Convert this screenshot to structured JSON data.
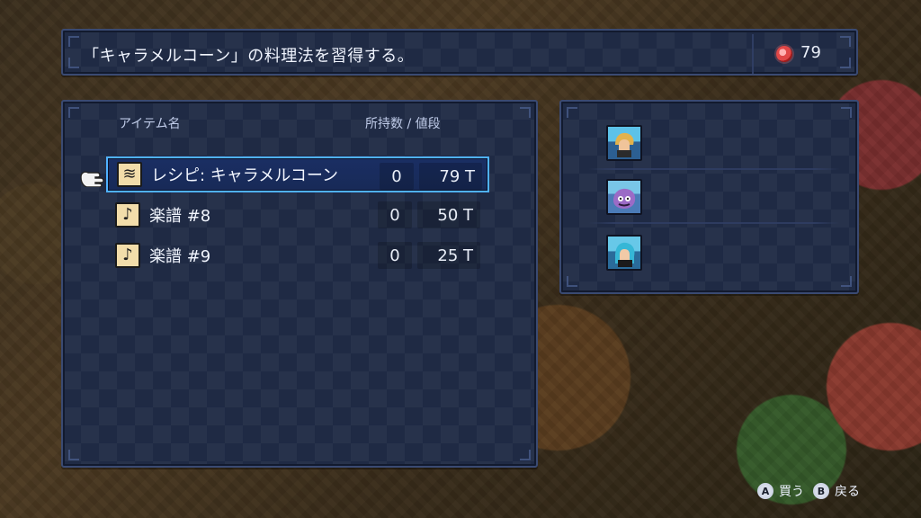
{
  "message": {
    "text": "「キャラメルコーン」の料理法を習得する。"
  },
  "currency": {
    "amount": "79",
    "icon": "coin-icon"
  },
  "shop": {
    "headers": {
      "item": "アイテム名",
      "owned_price": "所持数 / 値段"
    },
    "items": [
      {
        "name": "レシピ: キャラメルコーン",
        "qty": "0",
        "price": "79 T",
        "icon": "scroll-icon",
        "selected": true
      },
      {
        "name": "楽譜 #8",
        "qty": "0",
        "price": "50 T",
        "icon": "music-note-icon",
        "selected": false
      },
      {
        "name": "楽譜 #9",
        "qty": "0",
        "price": "25 T",
        "icon": "music-note-icon",
        "selected": false
      }
    ]
  },
  "party": {
    "members": [
      {
        "portrait": "blonde-hero-portrait"
      },
      {
        "portrait": "purple-creature-portrait"
      },
      {
        "portrait": "blue-hair-portrait"
      }
    ]
  },
  "help": {
    "a_label": "買う",
    "b_label": "戻る",
    "a_button": "A",
    "b_button": "B"
  },
  "colors": {
    "panel_bg": "#1f2a44",
    "panel_border": "#3a4a72",
    "selection_border": "#4fb1ff",
    "coin_red": "#e04747",
    "text": "#e9eef8"
  }
}
